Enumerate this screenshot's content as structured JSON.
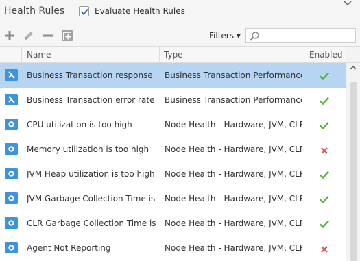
{
  "header": {
    "title": "Health Rules",
    "evaluate_label": "Evaluate Health Rules",
    "evaluate_checked": true
  },
  "toolbar": {
    "filters_label": "Filters ▾",
    "search_value": "",
    "search_placeholder": ""
  },
  "columns": {
    "name": "Name",
    "type": "Type",
    "enabled": "Enabled"
  },
  "rows": [
    {
      "name": "Business Transaction response",
      "type": "Business Transaction Performance",
      "icon": "business-transaction-icon",
      "enabled": true,
      "selected": true
    },
    {
      "name": "Business Transaction error rate is",
      "type": "Business Transaction Performance",
      "icon": "business-transaction-icon",
      "enabled": true,
      "selected": false
    },
    {
      "name": "CPU utilization is too high",
      "type": "Node Health - Hardware, JVM, CLR",
      "icon": "node-health-icon",
      "enabled": true,
      "selected": false
    },
    {
      "name": "Memory utilization is too high",
      "type": "Node Health - Hardware, JVM, CLR",
      "icon": "node-health-icon",
      "enabled": false,
      "selected": false
    },
    {
      "name": "JVM Heap utilization is too high",
      "type": "Node Health - Hardware, JVM, CLR",
      "icon": "node-health-icon",
      "enabled": true,
      "selected": false
    },
    {
      "name": "JVM Garbage Collection Time is",
      "type": "Node Health - Hardware, JVM, CLR",
      "icon": "node-health-icon",
      "enabled": true,
      "selected": false
    },
    {
      "name": "CLR Garbage Collection Time is",
      "type": "Node Health - Hardware, JVM, CLR",
      "icon": "node-health-icon",
      "enabled": true,
      "selected": false
    },
    {
      "name": "Agent Not Reporting",
      "type": "Node Health - Hardware, JVM, CLR",
      "icon": "node-health-icon",
      "enabled": false,
      "selected": false
    }
  ],
  "colors": {
    "selected_row": "#b7d4f3",
    "enabled_check": "#56b13b",
    "disabled_x": "#d9534f",
    "icon_blue": "#3d93dc"
  }
}
